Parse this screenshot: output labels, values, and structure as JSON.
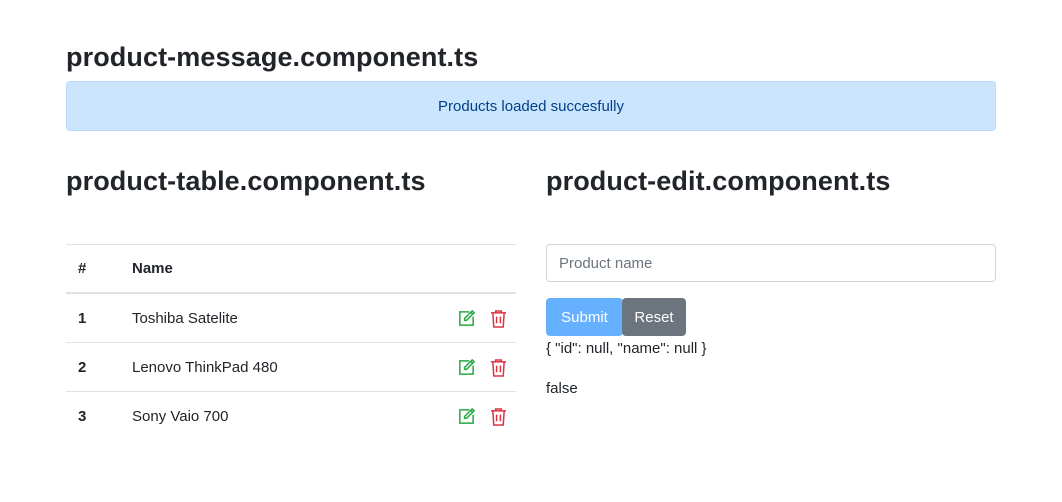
{
  "message": {
    "title": "product-message.component.ts",
    "alert": "Products loaded succesfully"
  },
  "table": {
    "title": "product-table.component.ts",
    "headers": [
      "#",
      "Name"
    ],
    "rows": [
      {
        "id": "1",
        "name": "Toshiba Satelite"
      },
      {
        "id": "2",
        "name": "Lenovo ThinkPad 480"
      },
      {
        "id": "3",
        "name": "Sony Vaio 700"
      }
    ],
    "colors": {
      "edit": "#28a745",
      "delete": "#dc3545"
    }
  },
  "edit": {
    "title": "product-edit.component.ts",
    "input_placeholder": "Product name",
    "input_value": "",
    "submit_label": "Submit",
    "reset_label": "Reset",
    "model_json": "{ \"id\": null, \"name\": null }",
    "flag": "false"
  }
}
